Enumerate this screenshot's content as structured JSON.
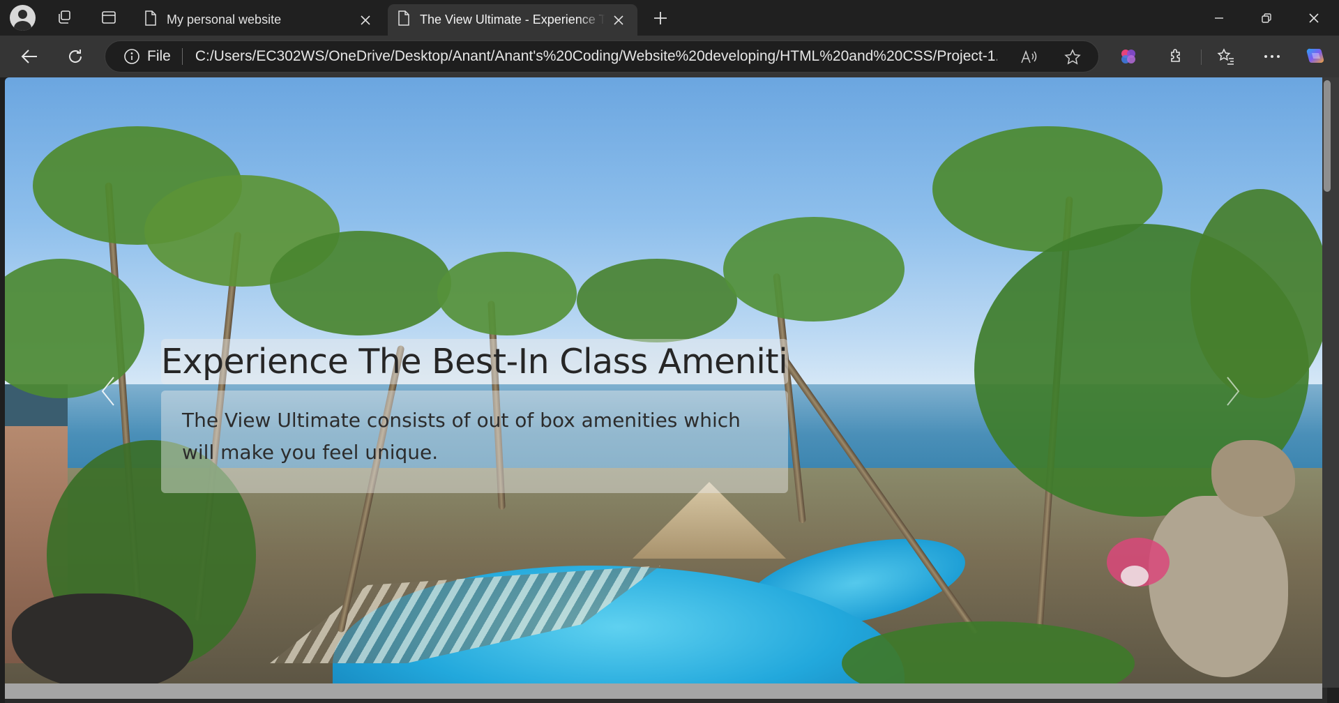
{
  "browser": {
    "tabs": [
      {
        "title": "My personal website",
        "icon": "page-icon",
        "active": false
      },
      {
        "title": "The View Ultimate - Experience The Best-In Class Amenities",
        "icon": "page-icon",
        "active": true
      }
    ],
    "address_bar": {
      "scheme_label": "File",
      "url": "C:/Users/EC302WS/OneDrive/Desktop/Anant/Anant's%20Coding/Website%20developing/HTML%20and%20CSS/Project-1..."
    }
  },
  "page": {
    "carousel": {
      "caption_title": "Experience The Best-In Class Amenities",
      "caption_text": "The View Ultimate consists of out of box amenities which will make you feel unique."
    }
  },
  "colors": {
    "tabstrip_bg": "#202020",
    "toolbar_bg": "#353535",
    "caption_bg": "rgba(235,235,235,0.45)"
  }
}
